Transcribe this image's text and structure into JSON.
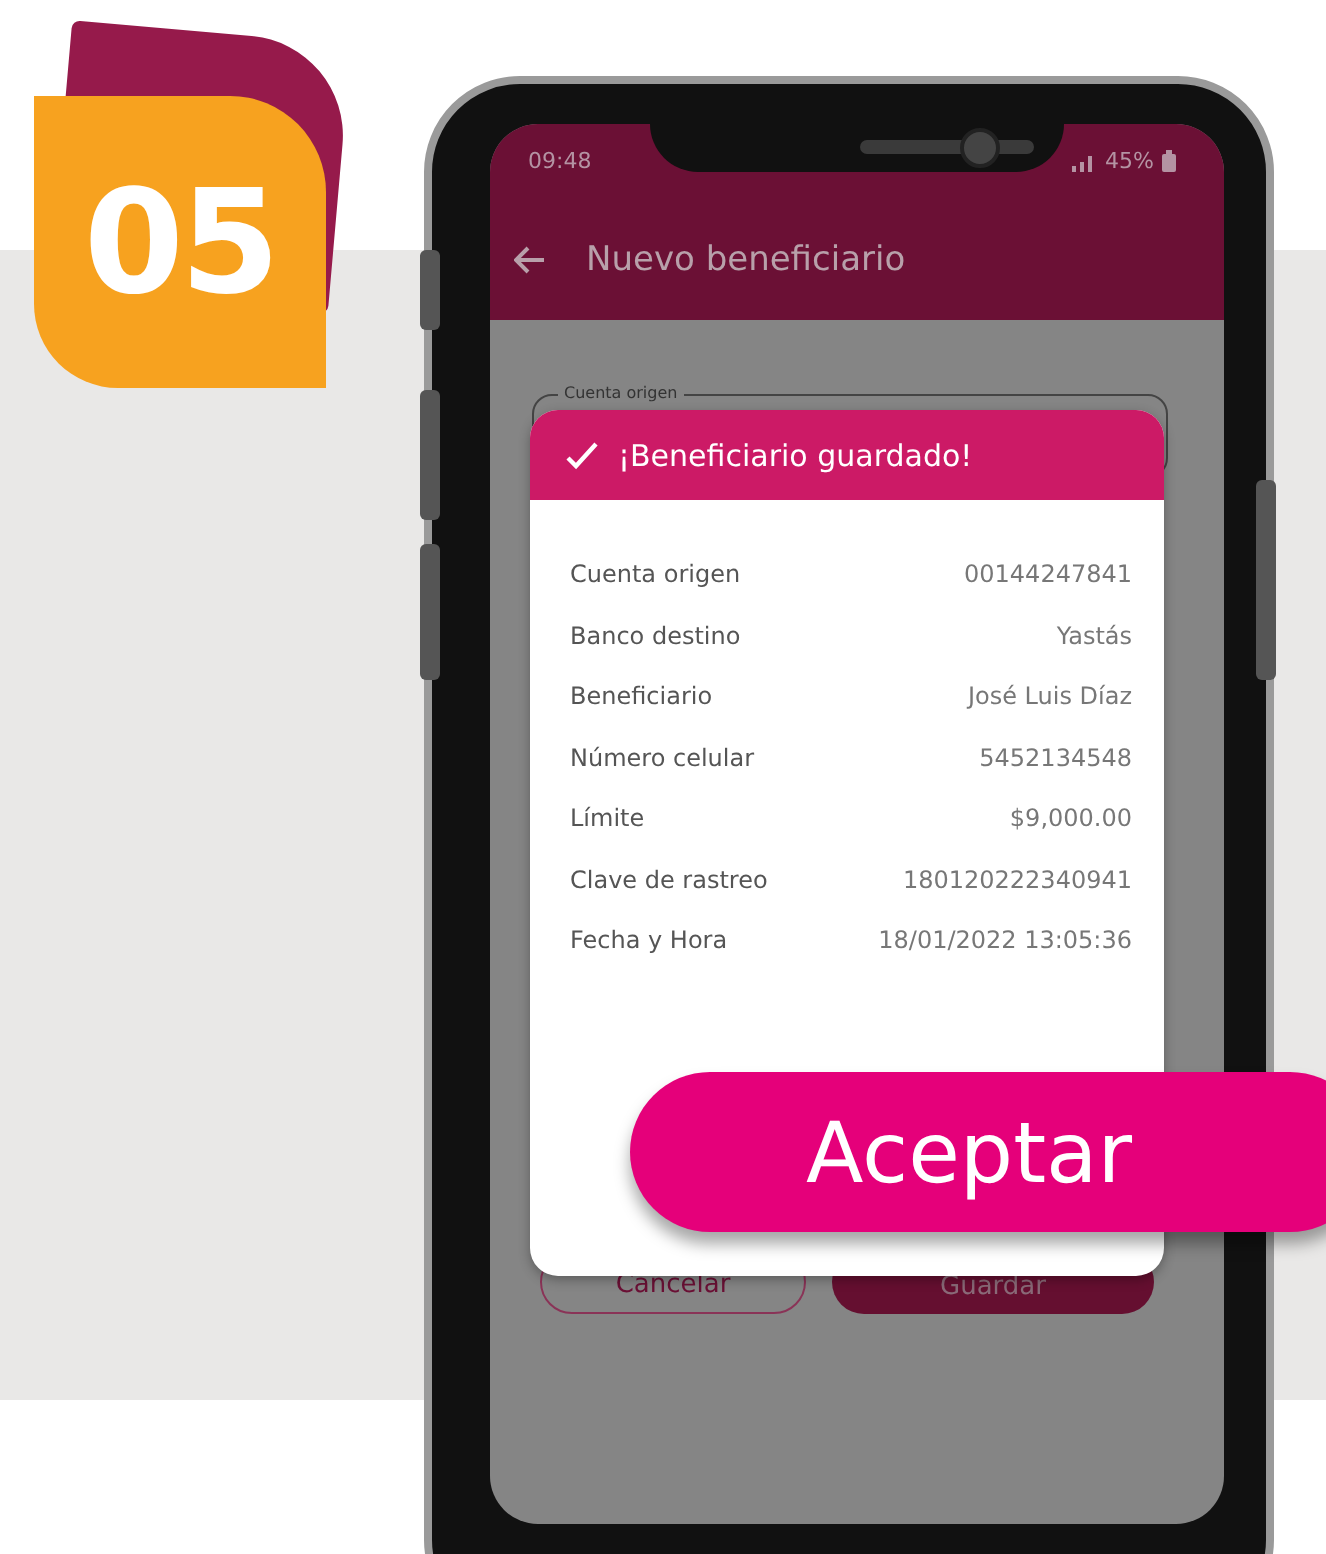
{
  "badge": {
    "number": "05"
  },
  "status_bar": {
    "time": "09:48",
    "battery": "45%"
  },
  "header": {
    "title": "Nuevo beneficiario"
  },
  "form": {
    "field_label": "Cuenta origen",
    "buttons": [
      {
        "label": "Cancelar",
        "kind": "outline"
      },
      {
        "label": "Guardar",
        "kind": "filled"
      }
    ]
  },
  "dialog": {
    "title": "¡Beneficiario guardado!",
    "rows": [
      {
        "label": "Cuenta origen",
        "value": "00144247841"
      },
      {
        "label": "Banco destino",
        "value": "Yastás"
      },
      {
        "label": "Beneficiario",
        "value": "José Luis Díaz"
      },
      {
        "label": "Número celular",
        "value": "5452134548"
      },
      {
        "label": "Límite",
        "value": "$9,000.00"
      },
      {
        "label": "Clave de rastreo",
        "value": "180120222340941"
      },
      {
        "label": "Fecha y Hora",
        "value": "18/01/2022 13:05:36"
      }
    ]
  },
  "accept_button": {
    "label": "Aceptar"
  }
}
